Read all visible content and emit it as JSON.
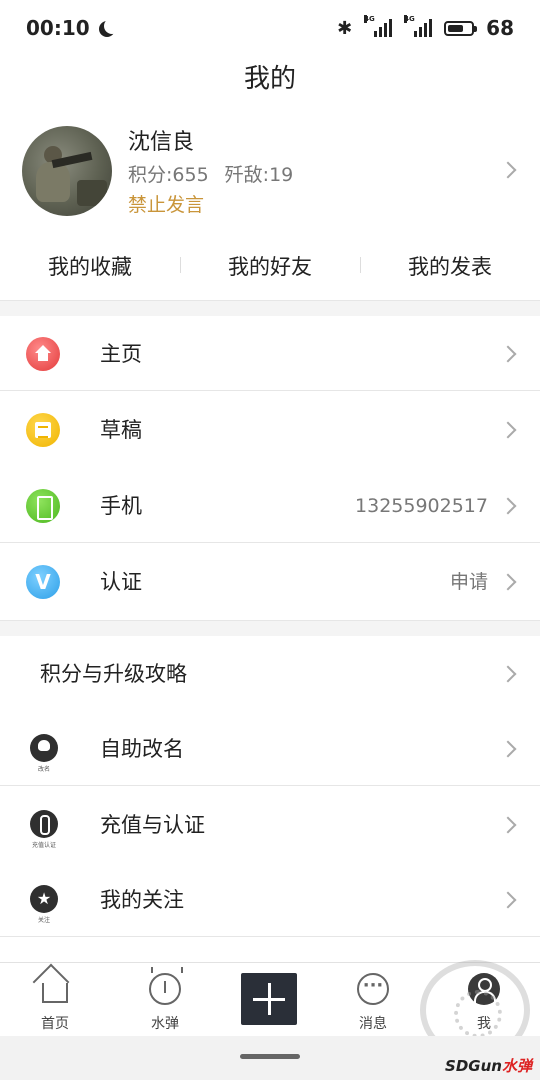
{
  "status_bar": {
    "time": "00:10",
    "net1": "4G",
    "net2": "4G",
    "battery_text": "68",
    "battery_level": 0.68
  },
  "page_title": "我的",
  "profile": {
    "name": "沈信良",
    "points": "积分:655",
    "kills": "歼敌:19",
    "ban_status": "禁止发言"
  },
  "tabs": [
    "我的收藏",
    "我的好友",
    "我的发表"
  ],
  "menu_group1": [
    {
      "label": "主页",
      "value": "",
      "icon": "home-icon"
    },
    {
      "label": "草稿",
      "value": "",
      "icon": "draft-icon"
    },
    {
      "label": "手机",
      "value": "13255902517",
      "icon": "phone-icon"
    },
    {
      "label": "认证",
      "value": "申请",
      "icon": "verify-v-icon"
    }
  ],
  "menu_group2": [
    {
      "label": "积分与升级攻略",
      "icon": ""
    },
    {
      "label": "自助改名",
      "icon": "skull-icon",
      "tiny": "改名"
    },
    {
      "label": "充值与认证",
      "icon": "charge-icon",
      "tiny": "充值认证"
    },
    {
      "label": "我的关注",
      "icon": "star-icon",
      "tiny": "关注"
    }
  ],
  "bottom_nav": {
    "home": "首页",
    "bomb": "水弹",
    "messages": "消息",
    "me": "我"
  },
  "watermark": {
    "text": "SDGun",
    "red": "水弹"
  },
  "colors": {
    "ban": "#c9953a",
    "accent_dark": "#2a2f38"
  }
}
